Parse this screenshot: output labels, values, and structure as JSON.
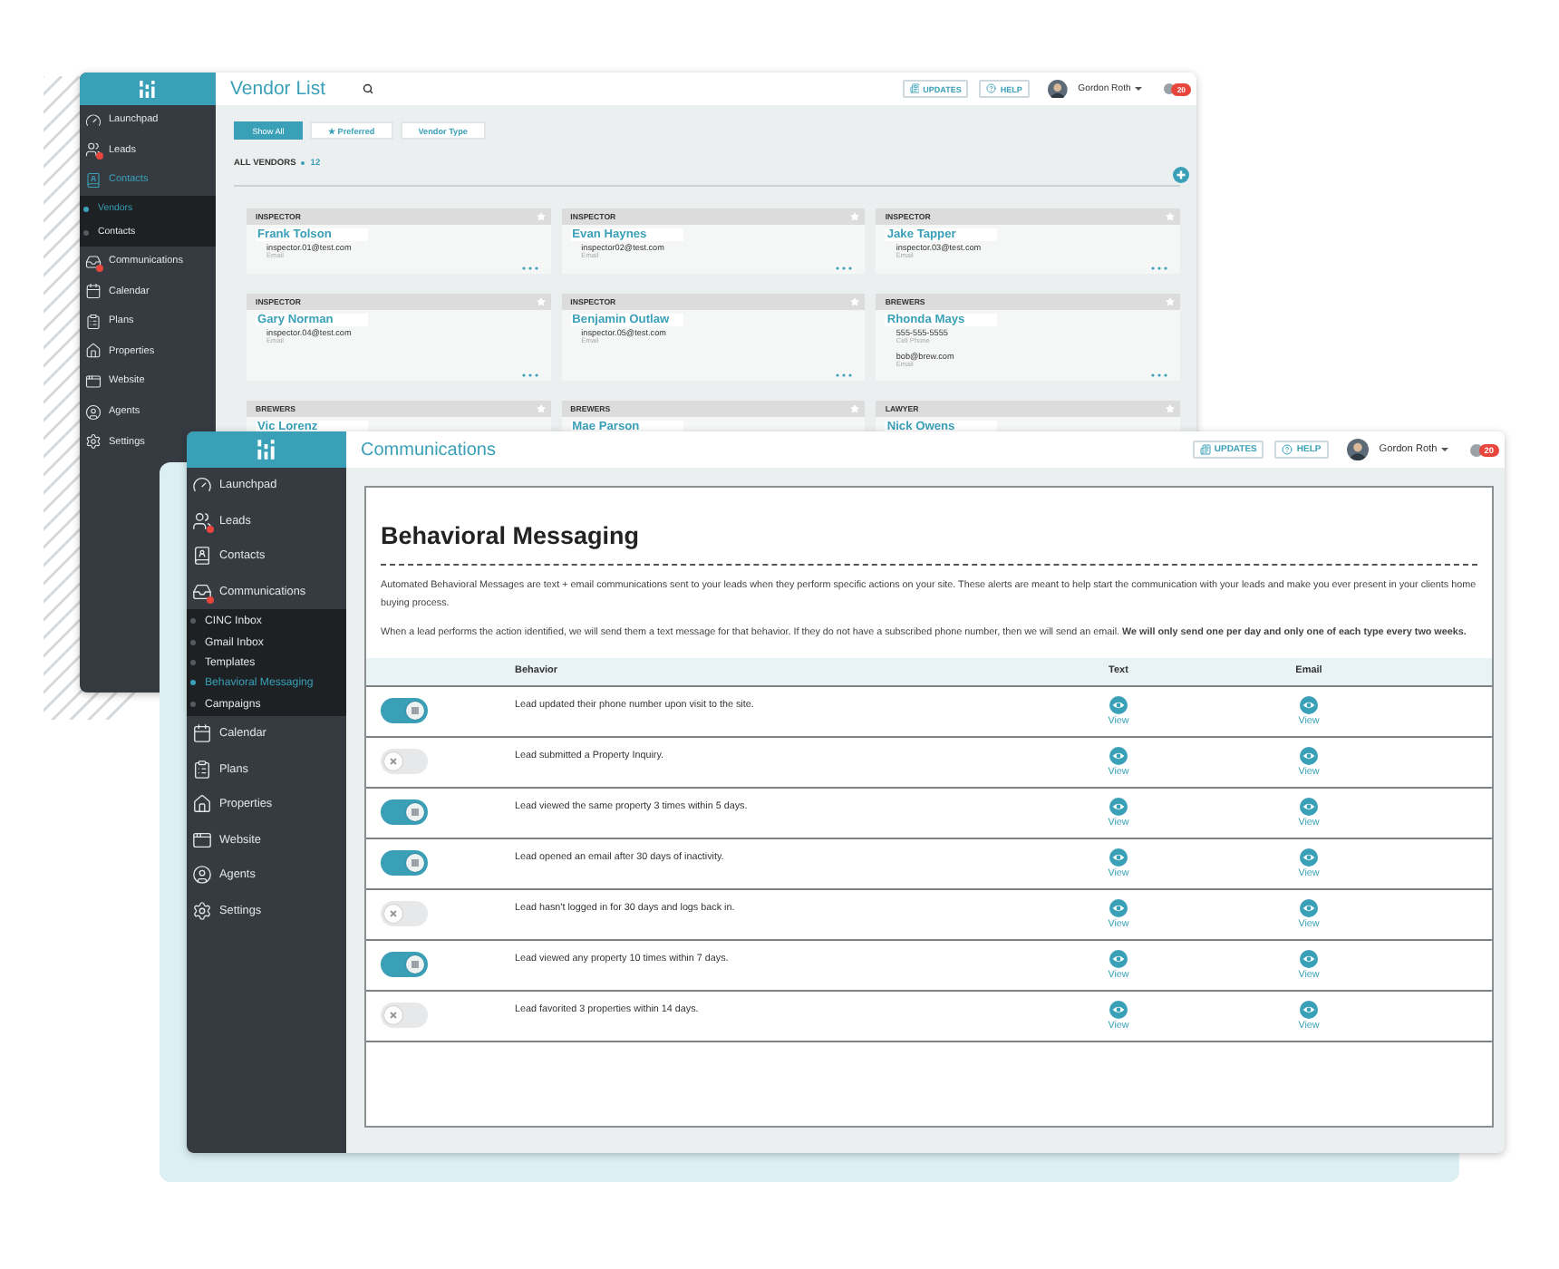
{
  "vendor_window": {
    "title": "Vendor List",
    "header": {
      "updates": "UPDATES",
      "help": "HELP",
      "user": "Gordon Roth",
      "badge": "20"
    },
    "sidebar": {
      "items": [
        {
          "label": "Launchpad",
          "selected": false,
          "alert": false
        },
        {
          "label": "Leads",
          "selected": false,
          "alert": true
        },
        {
          "label": "Contacts",
          "selected": true,
          "alert": false,
          "children": [
            {
              "label": "Vendors",
              "selected": true
            },
            {
              "label": "Contacts",
              "selected": false
            }
          ]
        },
        {
          "label": "Communications",
          "selected": false,
          "alert": true
        },
        {
          "label": "Calendar",
          "selected": false,
          "alert": false
        },
        {
          "label": "Plans",
          "selected": false,
          "alert": false
        },
        {
          "label": "Properties",
          "selected": false,
          "alert": false
        },
        {
          "label": "Website",
          "selected": false,
          "alert": false
        },
        {
          "label": "Agents",
          "selected": false,
          "alert": false
        },
        {
          "label": "Settings",
          "selected": false,
          "alert": false
        }
      ]
    },
    "filters": [
      {
        "label": "Show All",
        "selected": true
      },
      {
        "label": "★ Preferred",
        "selected": false
      },
      {
        "label": "Vendor Type",
        "selected": false
      }
    ],
    "section": {
      "label": "ALL VENDORS",
      "count": "12"
    },
    "vendors": [
      {
        "type": "INSPECTOR",
        "name": "Frank Tolson",
        "contacts": [
          {
            "value": "inspector.01@test.com",
            "label": "Email"
          }
        ]
      },
      {
        "type": "INSPECTOR",
        "name": "Evan Haynes",
        "contacts": [
          {
            "value": "inspector02@test.com",
            "label": "Email"
          }
        ]
      },
      {
        "type": "INSPECTOR",
        "name": "Jake Tapper",
        "contacts": [
          {
            "value": "inspector.03@test.com",
            "label": "Email"
          }
        ]
      },
      {
        "type": "INSPECTOR",
        "name": "Gary Norman",
        "contacts": [
          {
            "value": "inspector.04@test.com",
            "label": "Email"
          }
        ]
      },
      {
        "type": "INSPECTOR",
        "name": "Benjamin Outlaw",
        "contacts": [
          {
            "value": "inspector.05@test.com",
            "label": "Email"
          }
        ]
      },
      {
        "type": "BREWERS",
        "name": "Rhonda Mays",
        "contacts": [
          {
            "value": "555-555-5555",
            "label": "Cell Phone"
          },
          {
            "value": "bob@brew.com",
            "label": "Email"
          }
        ]
      },
      {
        "type": "BREWERS",
        "name": "Vic Lorenz"
      },
      {
        "type": "BREWERS",
        "name": "Mae Parson"
      },
      {
        "type": "LAWYER",
        "name": "Nick Owens"
      }
    ]
  },
  "communications_window": {
    "title": "Communications",
    "header": {
      "updates": "UPDATES",
      "help": "HELP",
      "user": "Gordon Roth",
      "badge": "20"
    },
    "sidebar": {
      "items": [
        {
          "label": "Launchpad",
          "selected": false,
          "alert": false
        },
        {
          "label": "Leads",
          "selected": false,
          "alert": true
        },
        {
          "label": "Contacts",
          "selected": false,
          "alert": false
        },
        {
          "label": "Communications",
          "selected": false,
          "alert": true,
          "children": [
            {
              "label": "CINC Inbox",
              "selected": false
            },
            {
              "label": "Gmail Inbox",
              "selected": false
            },
            {
              "label": "Templates",
              "selected": false
            },
            {
              "label": "Behavioral Messaging",
              "selected": true
            },
            {
              "label": "Campaigns",
              "selected": false
            }
          ]
        },
        {
          "label": "Calendar",
          "selected": false,
          "alert": false
        },
        {
          "label": "Plans",
          "selected": false,
          "alert": false
        },
        {
          "label": "Properties",
          "selected": false,
          "alert": false
        },
        {
          "label": "Website",
          "selected": false,
          "alert": false
        },
        {
          "label": "Agents",
          "selected": false,
          "alert": false
        },
        {
          "label": "Settings",
          "selected": false,
          "alert": false
        }
      ]
    },
    "page": {
      "title": "Behavioral Messaging",
      "paragraphs": [
        "Automated Behavioral Messages are text + email communications sent to your leads when they perform specific actions on your site. These alerts are meant to help start the communication with your leads and make you ever present in your clients home buying process.",
        "When a lead performs the action identified, we will send them a text message for that behavior. If they do not have a subscribed phone number, then we will send an email. **We will only send one per day and only one of each type every two weeks.**"
      ],
      "table": {
        "columns": [
          "Behavior",
          "Text",
          "Email"
        ],
        "rows": [
          {
            "on": true,
            "behavior": "Lead updated their phone number upon visit to the site.",
            "text_link": "View",
            "email_link": "View"
          },
          {
            "on": false,
            "behavior": "Lead submitted a Property Inquiry.",
            "text_link": "View",
            "email_link": "View"
          },
          {
            "on": true,
            "behavior": "Lead viewed the same property 3 times within 5 days.",
            "text_link": "View",
            "email_link": "View"
          },
          {
            "on": true,
            "behavior": "Lead opened an email after 30 days of inactivity.",
            "text_link": "View",
            "email_link": "View"
          },
          {
            "on": false,
            "behavior": "Lead hasn't logged in for 30 days and logs back in.",
            "text_link": "View",
            "email_link": "View"
          },
          {
            "on": true,
            "behavior": "Lead viewed any property 10 times within 7 days.",
            "text_link": "View",
            "email_link": "View"
          },
          {
            "on": false,
            "behavior": "Lead favorited 3 properties within 14 days.",
            "text_link": "View",
            "email_link": "View"
          }
        ]
      }
    }
  }
}
